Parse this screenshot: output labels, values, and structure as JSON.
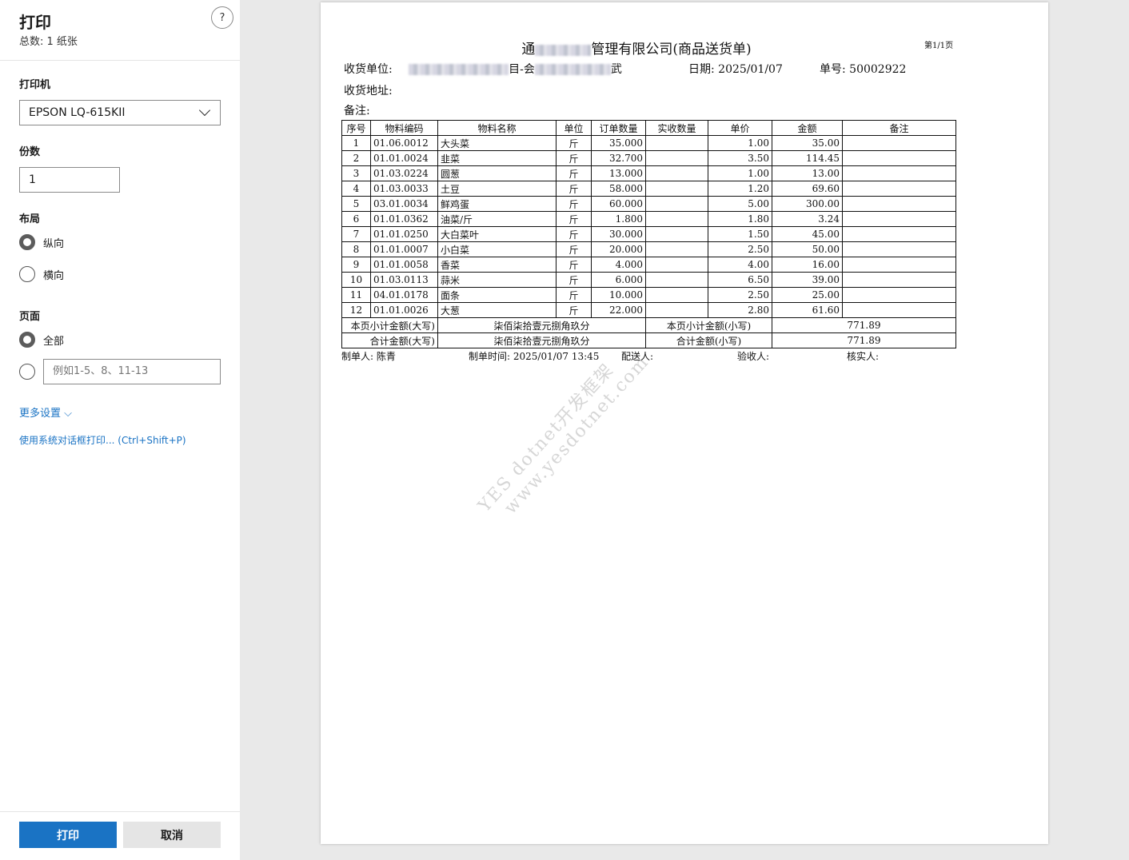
{
  "panel": {
    "title": "打印",
    "count": "总数: 1 纸张",
    "help": "?",
    "printer_label": "打印机",
    "printer_value": "EPSON LQ-615KII",
    "copies_label": "份数",
    "copies_value": "1",
    "layout_label": "布局",
    "layout_options": [
      {
        "label": "纵向",
        "selected": true
      },
      {
        "label": "横向",
        "selected": false
      }
    ],
    "pages_label": "页面",
    "pages_all": "全部",
    "pages_range_placeholder": "例如1-5、8、11-13",
    "more_settings": "更多设置 ⌵",
    "system_dialog": "使用系统对话框打印... (Ctrl+Shift+P)",
    "print_button": "打印",
    "cancel_button": "取消"
  },
  "document": {
    "title_prefix": "通",
    "title_suffix": "管理有限公司(商品送货单)",
    "page_no": "第1/1页",
    "receiver_label": "收货单位:",
    "receiver_mid": "目-会",
    "receiver_end": "武",
    "date": "日期: 2025/01/07",
    "order_no": "单号: 50002922",
    "address_label": "收货地址:",
    "remark_label": "备注:",
    "columns": [
      "序号",
      "物料编码",
      "物料名称",
      "单位",
      "订单数量",
      "实收数量",
      "单价",
      "金额",
      "备注"
    ],
    "rows": [
      [
        "1",
        "01.06.0012",
        "大头菜",
        "斤",
        "35.000",
        "",
        "1.00",
        "35.00",
        ""
      ],
      [
        "2",
        "01.01.0024",
        "韭菜",
        "斤",
        "32.700",
        "",
        "3.50",
        "114.45",
        ""
      ],
      [
        "3",
        "01.03.0224",
        "圆葱",
        "斤",
        "13.000",
        "",
        "1.00",
        "13.00",
        ""
      ],
      [
        "4",
        "01.03.0033",
        "土豆",
        "斤",
        "58.000",
        "",
        "1.20",
        "69.60",
        ""
      ],
      [
        "5",
        "03.01.0034",
        "鲜鸡蛋",
        "斤",
        "60.000",
        "",
        "5.00",
        "300.00",
        ""
      ],
      [
        "6",
        "01.01.0362",
        "油菜/斤",
        "斤",
        "1.800",
        "",
        "1.80",
        "3.24",
        ""
      ],
      [
        "7",
        "01.01.0250",
        "大白菜叶",
        "斤",
        "30.000",
        "",
        "1.50",
        "45.00",
        ""
      ],
      [
        "8",
        "01.01.0007",
        "小白菜",
        "斤",
        "20.000",
        "",
        "2.50",
        "50.00",
        ""
      ],
      [
        "9",
        "01.01.0058",
        "香菜",
        "斤",
        "4.000",
        "",
        "4.00",
        "16.00",
        ""
      ],
      [
        "10",
        "01.03.0113",
        "蒜米",
        "斤",
        "6.000",
        "",
        "6.50",
        "39.00",
        ""
      ],
      [
        "11",
        "04.01.0178",
        "面条",
        "斤",
        "10.000",
        "",
        "2.50",
        "25.00",
        ""
      ],
      [
        "12",
        "01.01.0026",
        "大葱",
        "斤",
        "22.000",
        "",
        "2.80",
        "61.60",
        ""
      ]
    ],
    "summary": [
      {
        "cap_big": "本页小计金额(大写)",
        "val_big": "柒佰柒拾壹元捌角玖分",
        "cap_small": "本页小计金额(小写)",
        "val_small": "771.89"
      },
      {
        "cap_big": "合计金额(大写)",
        "val_big": "柒佰柒拾壹元捌角玖分",
        "cap_small": "合计金额(小写)",
        "val_small": "771.89"
      }
    ],
    "maker": "制单人: 陈青",
    "make_time": "制单时间: 2025/01/07 13:45",
    "deliverer": "配送人:",
    "inspector": "验收人:",
    "verifier": "核实人:",
    "watermark_1": "YES dotnet开发框架",
    "watermark_2": "www.yesdotnet.com"
  }
}
